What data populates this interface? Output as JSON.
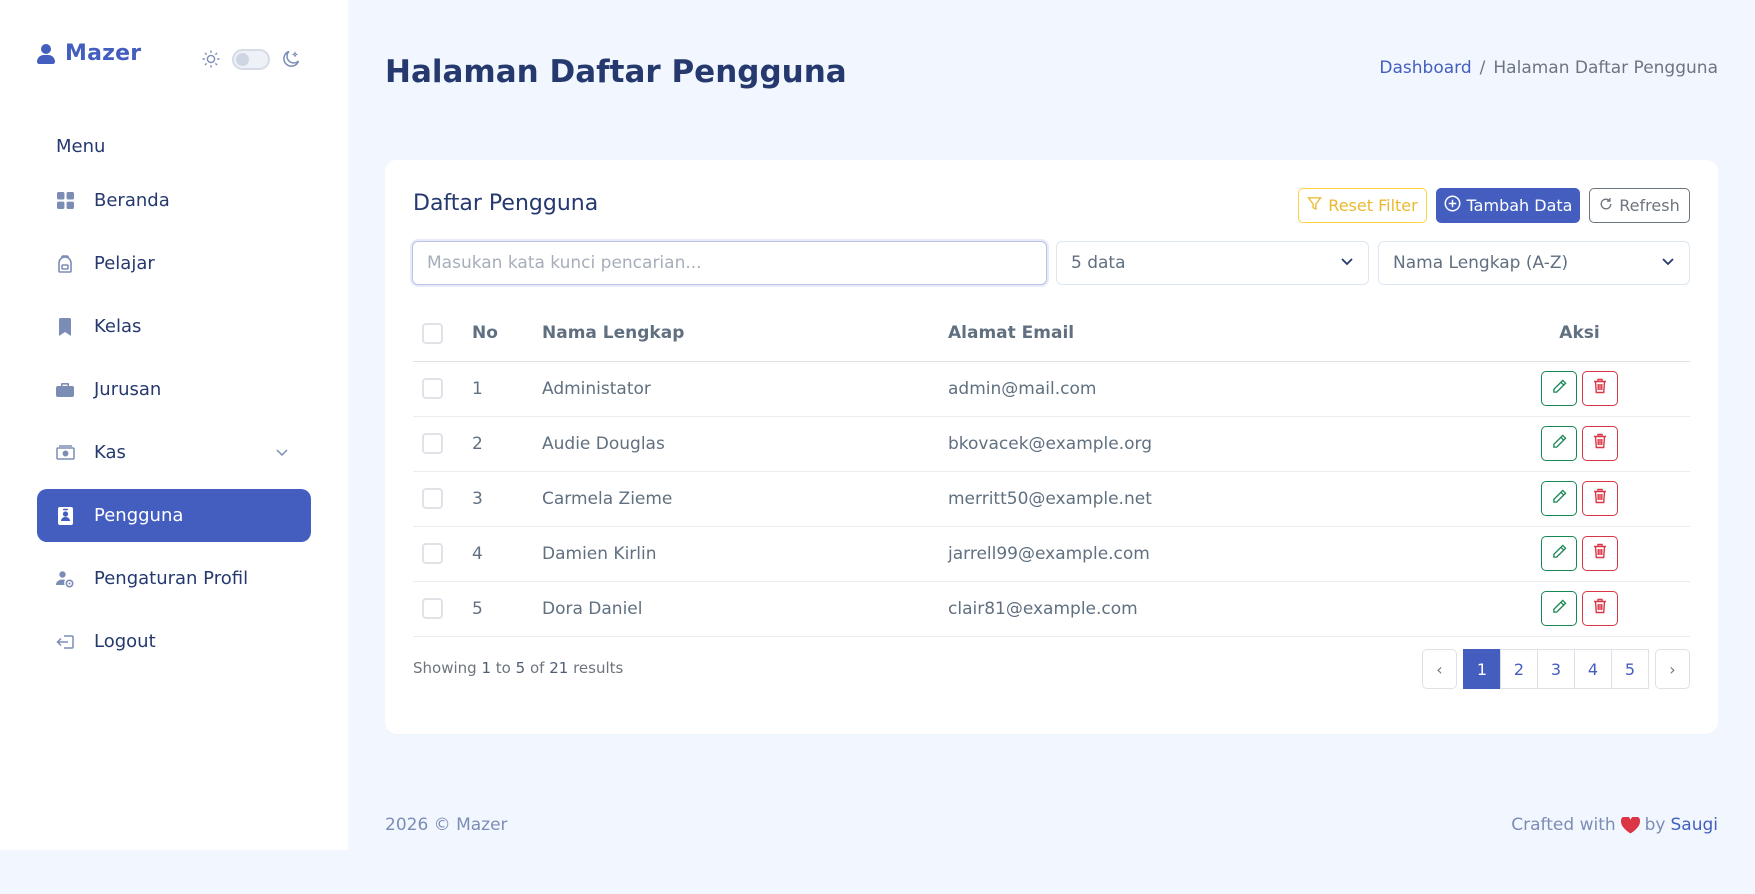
{
  "brand": {
    "name": "Mazer"
  },
  "sidebar": {
    "menu_title": "Menu",
    "items": [
      {
        "label": "Beranda",
        "icon": "grid-icon",
        "active": false
      },
      {
        "label": "Pelajar",
        "icon": "backpack-icon",
        "active": false
      },
      {
        "label": "Kelas",
        "icon": "bookmark-icon",
        "active": false
      },
      {
        "label": "Jurusan",
        "icon": "briefcase-icon",
        "active": false
      },
      {
        "label": "Kas",
        "icon": "cash-icon",
        "active": false,
        "has_submenu": true
      },
      {
        "label": "Pengguna",
        "icon": "person-badge-icon",
        "active": true
      },
      {
        "label": "Pengaturan Profil",
        "icon": "person-gear-icon",
        "active": false
      },
      {
        "label": "Logout",
        "icon": "logout-icon",
        "active": false
      }
    ]
  },
  "header": {
    "title": "Halaman Daftar Pengguna",
    "breadcrumb": {
      "link": "Dashboard",
      "separator": "/",
      "current": "Halaman Daftar Pengguna"
    }
  },
  "card": {
    "title": "Daftar Pengguna",
    "buttons": {
      "reset": "Reset Filter",
      "add": "Tambah Data",
      "refresh": "Refresh"
    },
    "search": {
      "placeholder": "Masukan kata kunci pencarian...",
      "value": ""
    },
    "per_page": "5 data",
    "sort": "Nama Lengkap (A-Z)",
    "table": {
      "headers": {
        "no": "No",
        "name": "Nama Lengkap",
        "email": "Alamat Email",
        "aksi": "Aksi"
      },
      "rows": [
        {
          "no": "1",
          "name": "Administator",
          "email": "admin@mail.com"
        },
        {
          "no": "2",
          "name": "Audie Douglas",
          "email": "bkovacek@example.org"
        },
        {
          "no": "3",
          "name": "Carmela Zieme",
          "email": "merritt50@example.net"
        },
        {
          "no": "4",
          "name": "Damien Kirlin",
          "email": "jarrell99@example.com"
        },
        {
          "no": "5",
          "name": "Dora Daniel",
          "email": "clair81@example.com"
        }
      ]
    },
    "showing": {
      "w1": "Showing",
      "from": "1",
      "w2": "to",
      "to": "5",
      "w3": "of",
      "total": "21",
      "w4": "results"
    },
    "pagination": {
      "prev": "‹",
      "pages": [
        "1",
        "2",
        "3",
        "4",
        "5"
      ],
      "active": "1",
      "next": "›"
    }
  },
  "footer": {
    "left": "2026 © Mazer",
    "crafted": "Crafted with",
    "by": "by",
    "author": "Saugi"
  },
  "colors": {
    "primary": "#435ebe",
    "warning": "#ffd23f",
    "success": "#198754",
    "danger": "#dc3545",
    "background": "#f2f7ff"
  }
}
